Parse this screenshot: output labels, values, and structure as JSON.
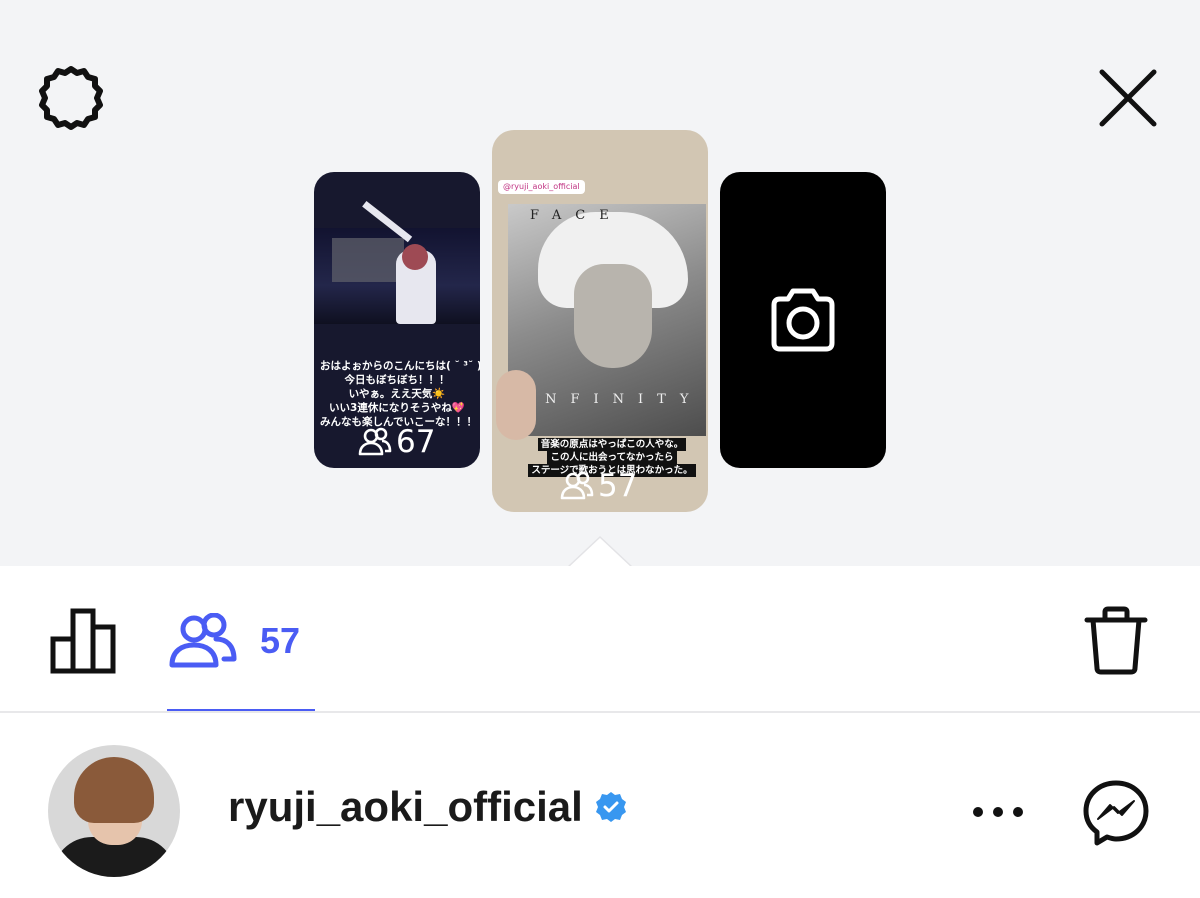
{
  "stories": {
    "left": {
      "caption_lines": [
        "おはよぉからのこんにちは( ˘ ³˘ )♡",
        "今日もぼちぼち！！！",
        "いやぁ。ええ天気☀️",
        "いい3連休になりそうやね💖",
        "みんなも楽しんでいこーな！！！"
      ],
      "viewer_count": "67"
    },
    "center": {
      "mention_tag": "@ryuji_aoki_official",
      "album_title_top": "FACE",
      "album_title_bottom": "INFINITY",
      "caption_lines": [
        "音楽の原点はやっぱこの人やな。",
        "この人に出会ってなかったら",
        "ステージで歌おうとは思わなかった。"
      ],
      "viewer_count": "57"
    },
    "right": {
      "icon": "camera-icon"
    }
  },
  "toolbar": {
    "viewers_count": "57",
    "accent_color": "#4a5cf4"
  },
  "viewer": {
    "username": "ryuji_aoki_official",
    "verified": true,
    "verified_color": "#3897f0"
  }
}
